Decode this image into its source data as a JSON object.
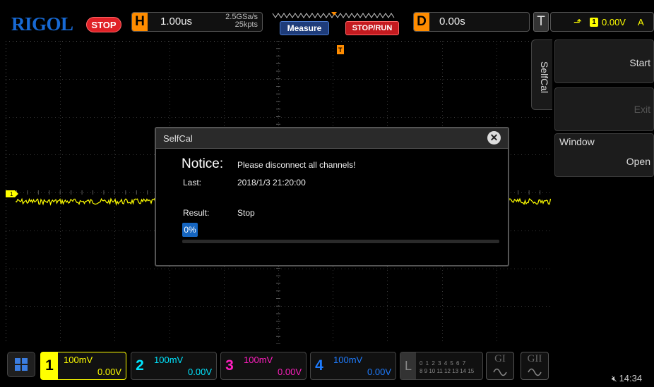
{
  "top_bar": {
    "brand": "RIGOL",
    "run_state": "STOP",
    "horizontal": {
      "letter": "H",
      "timebase": "1.00us",
      "sample_rate": "2.5GSa/s",
      "memory_depth": "25kpts"
    },
    "measure_label": "Measure",
    "stop_run_label": "STOP/RUN",
    "delay": {
      "letter": "D",
      "value": "0.00s"
    },
    "trigger": {
      "letter": "T",
      "source_channel": "1",
      "level": "0.00V",
      "mode": "A"
    }
  },
  "side_menu": {
    "tab_label": "SelfCal",
    "start_label": "Start",
    "exit_label": "Exit",
    "window_title": "Window",
    "window_value": "Open"
  },
  "dialog": {
    "title": "SelfCal",
    "notice_label": "Notice:",
    "notice_message": "Please disconnect all channels!",
    "last_label": "Last:",
    "last_value": "2018/1/3 21:20:00",
    "result_label": "Result:",
    "result_value": "Stop",
    "progress_text": "0%",
    "progress_fraction": 0.0
  },
  "channels": [
    {
      "number": "1",
      "scale": "100mV",
      "offset": "0.00V",
      "color": "#ffff00"
    },
    {
      "number": "2",
      "scale": "100mV",
      "offset": "0.00V",
      "color": "#00e5ff"
    },
    {
      "number": "3",
      "scale": "100mV",
      "offset": "0.00V",
      "color": "#ff1fbf"
    },
    {
      "number": "4",
      "scale": "100mV",
      "offset": "0.00V",
      "color": "#1e7cff"
    }
  ],
  "logic_analyzer": {
    "letter": "L",
    "row1": "0 1 2 3  4 5 6 7",
    "row2": "8 9 10 11 12 13 14 15"
  },
  "generators": [
    {
      "label": "GI"
    },
    {
      "label": "GII"
    }
  ],
  "waveform": {
    "channel_marker": "1",
    "color": "#ffff00"
  },
  "status": {
    "time": "14:34"
  },
  "colors": {
    "brand_blue": "#1769d4",
    "stop_red": "#e02127",
    "horizontal_orange": "#ff8c00",
    "progress_blue": "#1565c0"
  },
  "icons": {
    "home": "grid-home-icon",
    "speaker": "speaker-mute-icon",
    "close": "close-icon",
    "trigger_edge": "rising-edge-icon",
    "trigger_marker": "trigger-position-marker-icon"
  }
}
